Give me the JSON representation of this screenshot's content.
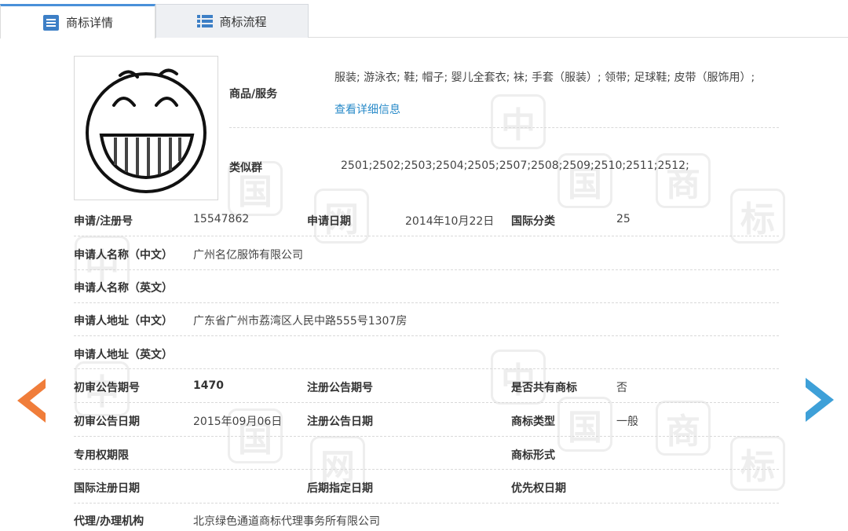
{
  "tabs": {
    "details_label": "商标详情",
    "process_label": "商标流程"
  },
  "watermark": {
    "chars": [
      "中",
      "国",
      "商",
      "标",
      "网"
    ]
  },
  "goods": {
    "label": "商品/服务",
    "value": "服装; 游泳衣; 鞋; 帽子; 婴儿全套衣; 袜; 手套（服装）; 领带; 足球鞋; 皮带（服饰用）;",
    "more_link": "查看详细信息"
  },
  "similar_group": {
    "label": "类似群",
    "value": "2501;2502;2503;2504;2505;2507;2508;2509;2510;2511;2512;"
  },
  "fields": {
    "reg_no_label": "申请/注册号",
    "reg_no": "15547862",
    "app_date_label": "申请日期",
    "app_date": "2014年10月22日",
    "intl_class_label": "国际分类",
    "intl_class": "25",
    "applicant_cn_label": "申请人名称（中文）",
    "applicant_cn": "广州名亿服饰有限公司",
    "applicant_en_label": "申请人名称（英文）",
    "address_cn_label": "申请人地址（中文）",
    "address_cn": "广东省广州市荔湾区人民中路555号1307房",
    "address_en_label": "申请人地址（英文）",
    "prelim_no_label": "初审公告期号",
    "prelim_no": "1470",
    "reg_pub_no_label": "注册公告期号",
    "shared_label": "是否共有商标",
    "shared": "否",
    "prelim_date_label": "初审公告日期",
    "prelim_date": "2015年09月06日",
    "reg_pub_date_label": "注册公告日期",
    "type_label": "商标类型",
    "type": "一般",
    "exclusive_label": "专用权期限",
    "form_label": "商标形式",
    "intl_reg_date_label": "国际注册日期",
    "later_date_label": "后期指定日期",
    "priority_label": "优先权日期",
    "agent_label": "代理/办理机构",
    "agent": "北京绿色通道商标代理事务所有限公司"
  },
  "colors": {
    "tab_accent": "#4a90d9",
    "link": "#2a8bc9",
    "prev_arrow": "#f07d3a",
    "next_arrow": "#3ea0d8"
  }
}
